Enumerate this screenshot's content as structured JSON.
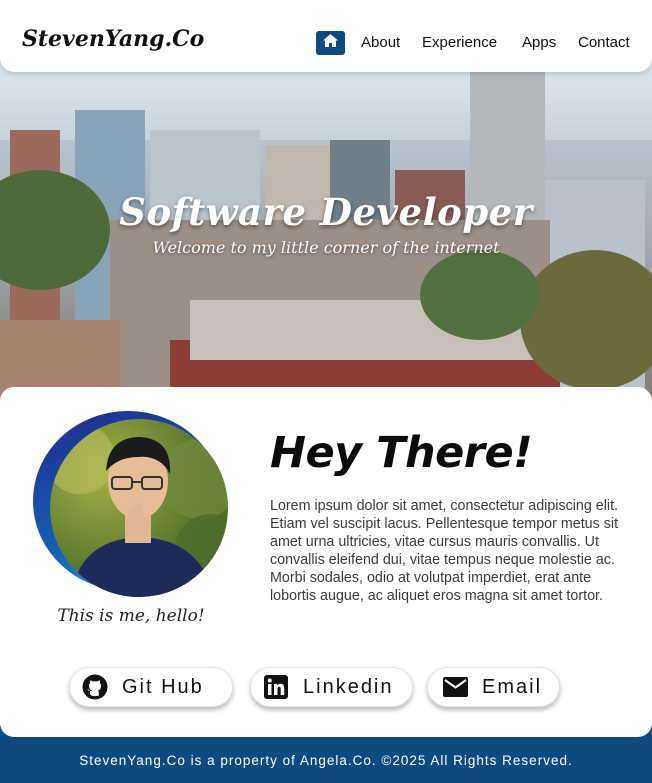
{
  "nav": {
    "logo": "StevenYang.Co",
    "links": [
      "About",
      "Experience",
      "Apps",
      "Contact"
    ]
  },
  "hero": {
    "title": "Software Developer",
    "subtitle": "Welcome to my little corner of the internet"
  },
  "about": {
    "heading": "Hey There!",
    "body": "Lorem ipsum dolor sit amet, consectetur adipiscing elit. Etiam vel  suscipit lacus. Pellentesque tempor metus sit amet urna ultricies, vitae cursus mauris convallis. Ut convallis eleifend dui, vitae tempus neque  molestie ac. Morbi sodales, odio at volutpat imperdiet, erat ante lobortis augue, ac aliquet eros magna sit amet tortor.",
    "caption": "This is me, hello!"
  },
  "buttons": [
    {
      "label": "Git Hub",
      "icon": "github-icon"
    },
    {
      "label": "Linkedin",
      "icon": "linkedin-icon"
    },
    {
      "label": "Email",
      "icon": "email-icon"
    }
  ],
  "footer": {
    "text": "StevenYang.Co is a property of Angela.Co. ©2025 All Rights Reserved."
  },
  "colors": {
    "primary": "#0c4a80",
    "avatar_ring_start": "#1f2a8c",
    "avatar_ring_end": "#12a7d6"
  }
}
